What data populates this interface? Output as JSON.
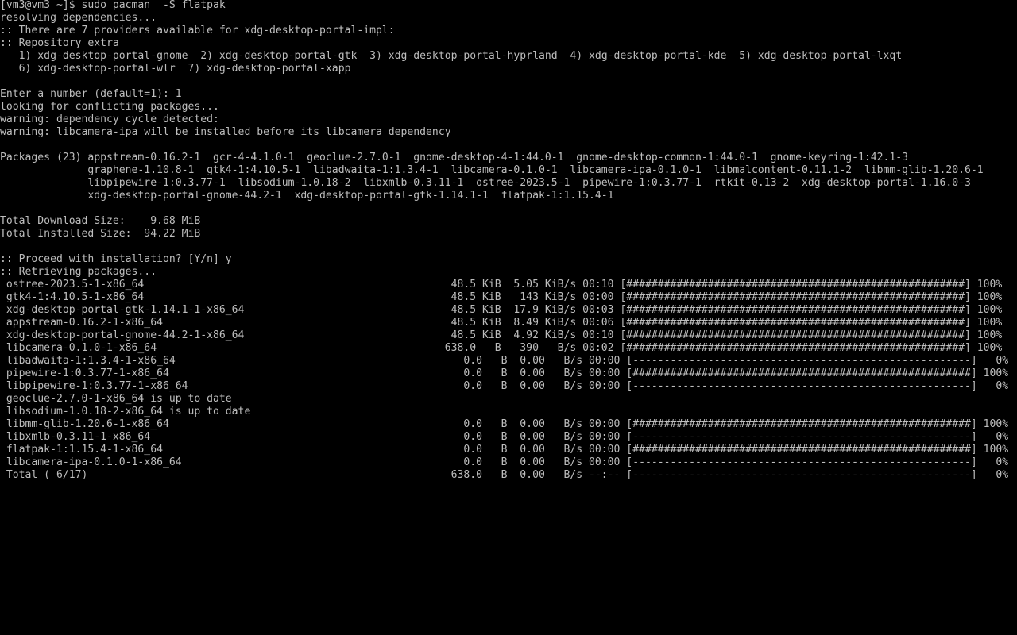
{
  "terminal": {
    "lines": [
      "[vm3@vm3 ~]$ sudo pacman  -S flatpak",
      "resolving dependencies...",
      ":: There are 7 providers available for xdg-desktop-portal-impl:",
      ":: Repository extra",
      "   1) xdg-desktop-portal-gnome  2) xdg-desktop-portal-gtk  3) xdg-desktop-portal-hyprland  4) xdg-desktop-portal-kde  5) xdg-desktop-portal-lxqt",
      "   6) xdg-desktop-portal-wlr  7) xdg-desktop-portal-xapp",
      "",
      "Enter a number (default=1): 1",
      "looking for conflicting packages...",
      "warning: dependency cycle detected:",
      "warning: libcamera-ipa will be installed before its libcamera dependency",
      "",
      "Packages (23) appstream-0.16.2-1  gcr-4-4.1.0-1  geoclue-2.7.0-1  gnome-desktop-4-1:44.0-1  gnome-desktop-common-1:44.0-1  gnome-keyring-1:42.1-3",
      "              graphene-1.10.8-1  gtk4-1:4.10.5-1  libadwaita-1:1.3.4-1  libcamera-0.1.0-1  libcamera-ipa-0.1.0-1  libmalcontent-0.11.1-2  libmm-glib-1.20.6-1",
      "              libpipewire-1:0.3.77-1  libsodium-1.0.18-2  libxmlb-0.3.11-1  ostree-2023.5-1  pipewire-1:0.3.77-1  rtkit-0.13-2  xdg-desktop-portal-1.16.0-3",
      "              xdg-desktop-portal-gnome-44.2-1  xdg-desktop-portal-gtk-1.14.1-1  flatpak-1:1.15.4-1",
      "",
      "Total Download Size:    9.68 MiB",
      "Total Installed Size:  94.22 MiB",
      "",
      ":: Proceed with installation? [Y/n] y",
      ":: Retrieving packages...",
      " ostree-2023.5-1-x86_64                                                 48.5 KiB  5.05 KiB/s 00:10 [######################################################] 100%",
      " gtk4-1:4.10.5-1-x86_64                                                 48.5 KiB   143 KiB/s 00:00 [######################################################] 100%",
      " xdg-desktop-portal-gtk-1.14.1-1-x86_64                                 48.5 KiB  17.9 KiB/s 00:03 [######################################################] 100%",
      " appstream-0.16.2-1-x86_64                                              48.5 KiB  8.49 KiB/s 00:06 [######################################################] 100%",
      " xdg-desktop-portal-gnome-44.2-1-x86_64                                 48.5 KiB  4.92 KiB/s 00:10 [######################################################] 100%",
      " libcamera-0.1.0-1-x86_64                                              638.0   B   390   B/s 00:02 [######################################################] 100%",
      " libadwaita-1:1.3.4-1-x86_64                                              0.0   B  0.00   B/s 00:00 [------------------------------------------------------]   0%",
      " pipewire-1:0.3.77-1-x86_64                                               0.0   B  0.00   B/s 00:00 [######################################################] 100%",
      " libpipewire-1:0.3.77-1-x86_64                                            0.0   B  0.00   B/s 00:00 [------------------------------------------------------]   0%",
      " geoclue-2.7.0-1-x86_64 is up to date",
      " libsodium-1.0.18-2-x86_64 is up to date",
      " libmm-glib-1.20.6-1-x86_64                                               0.0   B  0.00   B/s 00:00 [######################################################] 100%",
      " libxmlb-0.3.11-1-x86_64                                                  0.0   B  0.00   B/s 00:00 [------------------------------------------------------]   0%",
      " flatpak-1:1.15.4-1-x86_64                                                0.0   B  0.00   B/s 00:00 [######################################################] 100%",
      " libcamera-ipa-0.1.0-1-x86_64                                             0.0   B  0.00   B/s 00:00 [------------------------------------------------------]   0%",
      " Total ( 6/17)                                                          638.0   B  0.00   B/s --:-- [------------------------------------------------------]   0%"
    ]
  },
  "colors": {
    "background": "#000000",
    "foreground": "#bdbdbd"
  }
}
